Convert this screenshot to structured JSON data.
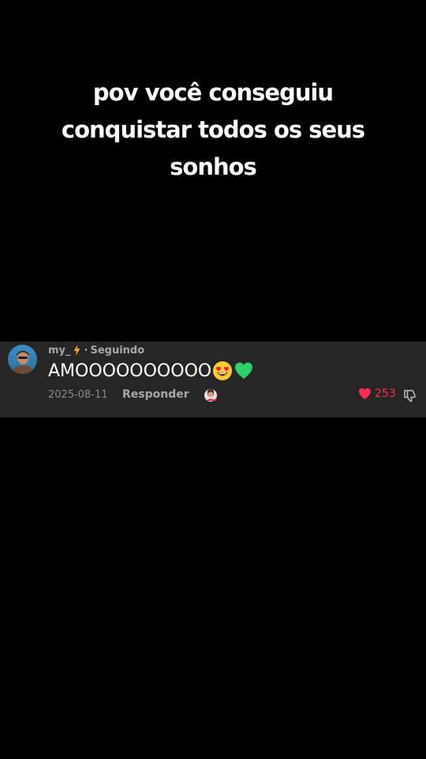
{
  "caption": {
    "lines": [
      "pov você conseguiu",
      "conquistar todos os seus",
      "sonhos"
    ]
  },
  "comment": {
    "username": "my_",
    "username_icon": "lightning-bolt-icon",
    "separator": "·",
    "follow_status": "Seguindo",
    "text": "AMOOOOOOOOOO",
    "emojis": [
      "heart-eyes-emoji",
      "green-heart-emoji"
    ],
    "date": "2025-08-11",
    "reply_label": "Responder",
    "like_count": "253",
    "liked": true
  },
  "colors": {
    "background": "#000000",
    "card_background": "#262626",
    "like_red": "#fe2c55",
    "meta_gray": "#a8a8a8"
  }
}
